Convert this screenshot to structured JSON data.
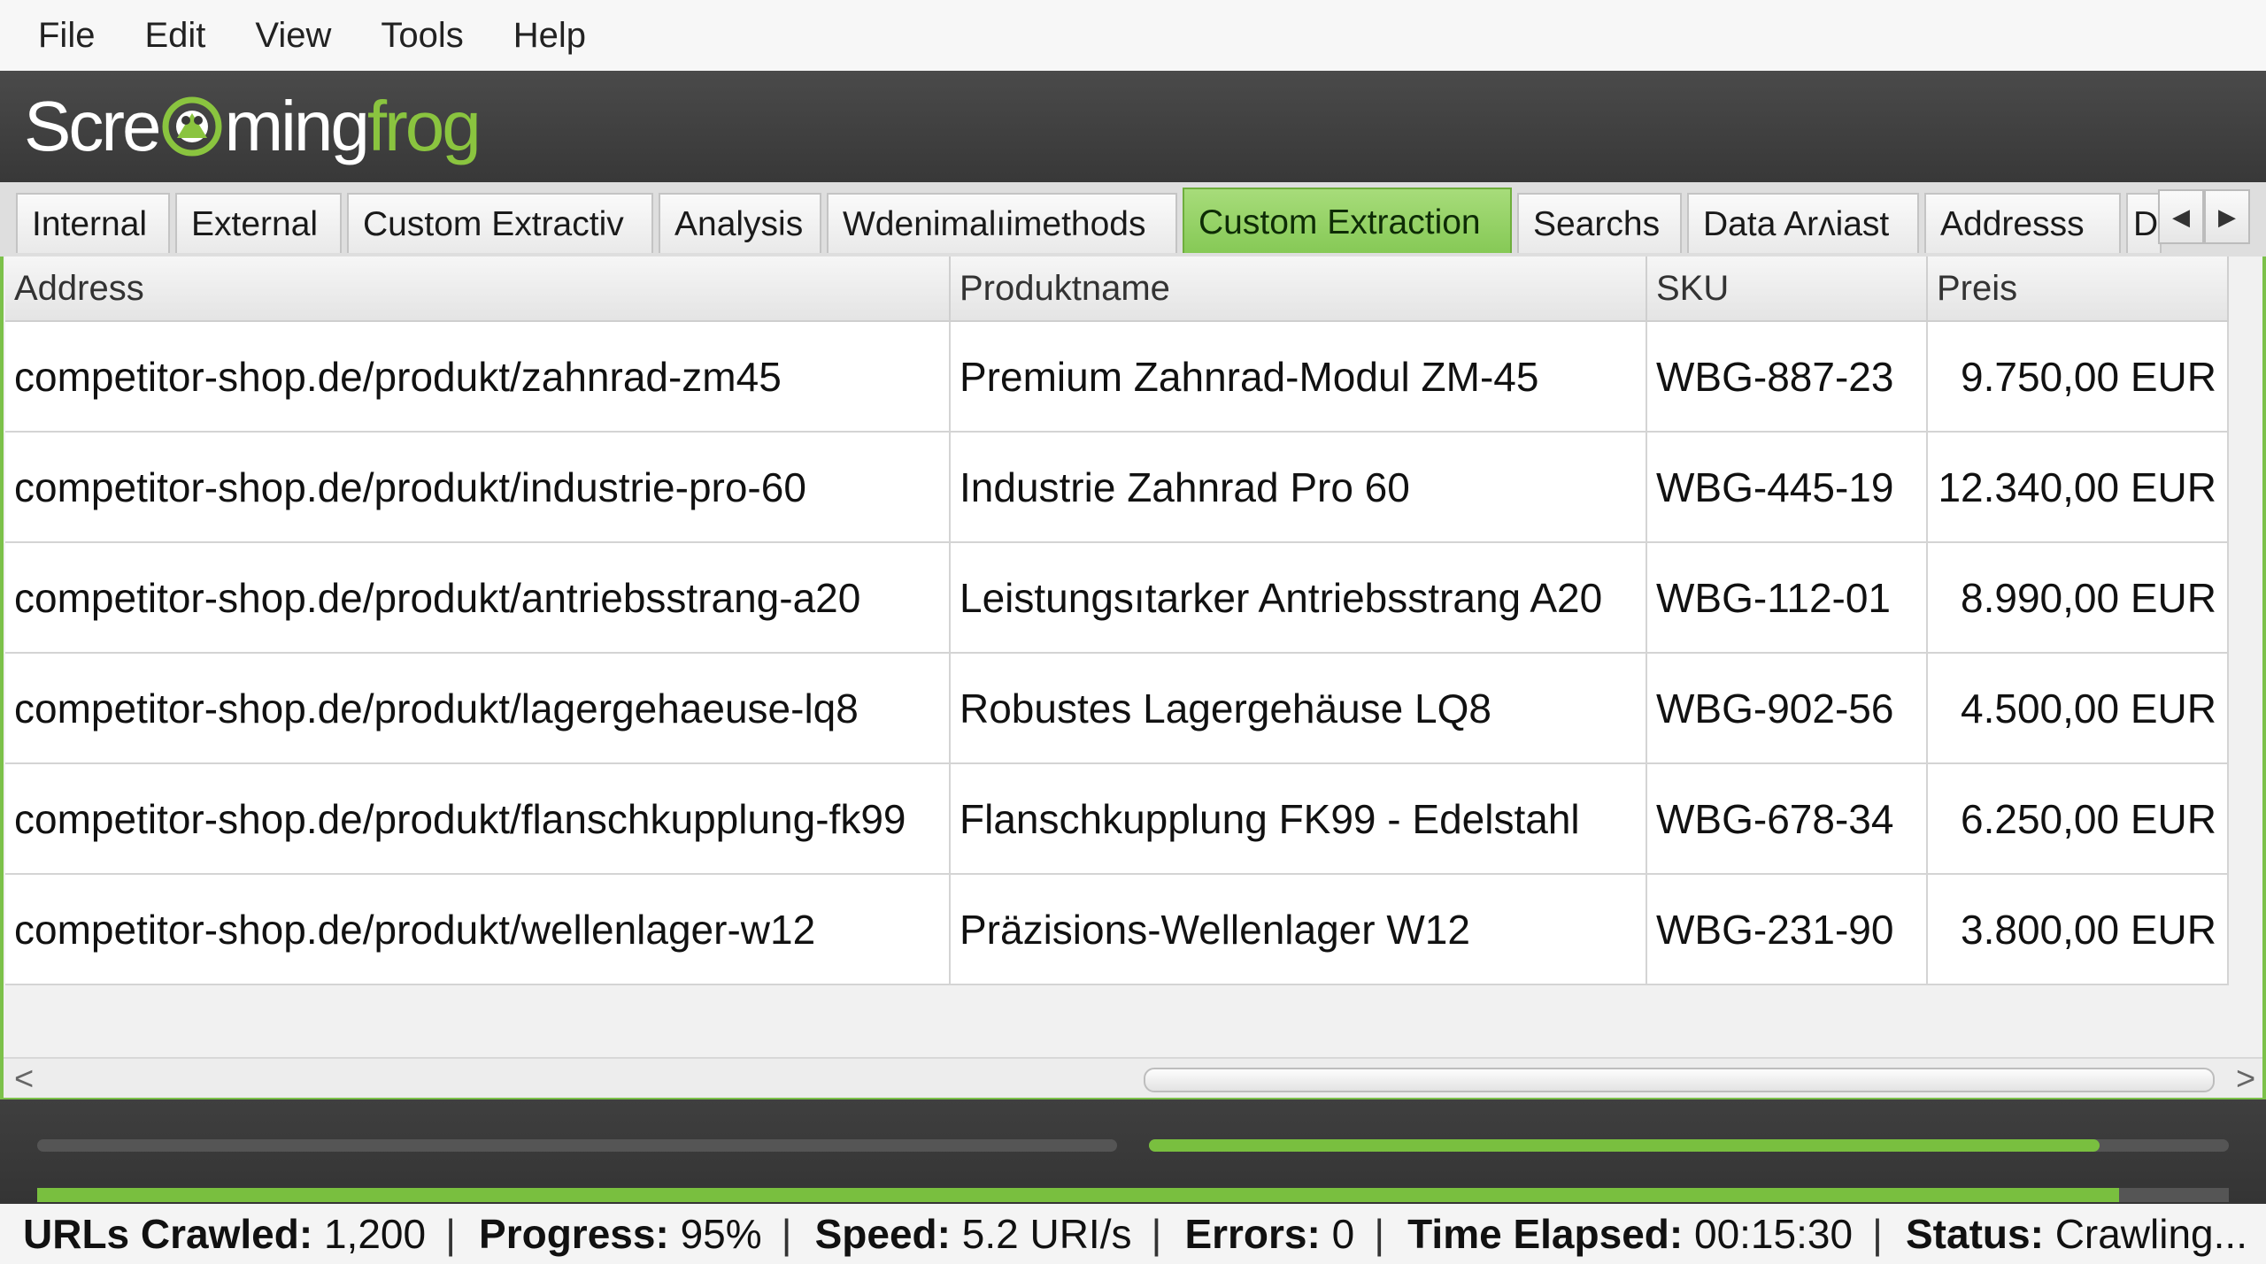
{
  "menu": [
    "File",
    "Edit",
    "View",
    "Tools",
    "Help"
  ],
  "brand": {
    "logo_white": "Scre",
    "logo_white2": "ming",
    "logo_green": "frog",
    "logo_icon": "frog-mascot-icon",
    "accent_color": "#8ac43f"
  },
  "tabs": [
    {
      "label": "Internal",
      "active": false
    },
    {
      "label": "External",
      "active": false
    },
    {
      "label": "Custom Extractiv",
      "active": false
    },
    {
      "label": "Analysis",
      "active": false
    },
    {
      "label": "Wdenimalıimethods",
      "active": false
    },
    {
      "label": "Custom Extraction",
      "active": true
    },
    {
      "label": "Searchs",
      "active": false
    },
    {
      "label": "Data Arʌiast",
      "active": false
    },
    {
      "label": "Addresss",
      "active": false
    },
    {
      "label": "D",
      "active": false
    }
  ],
  "tab_nav": {
    "prev_icon": "chevron-left-icon",
    "next_icon": "chevron-right-icon"
  },
  "table": {
    "columns": [
      "Address",
      "Produktname",
      "SKU",
      "Preis"
    ],
    "rows": [
      [
        "competitor-shop.de/produkt/zahnrad-zm45",
        "Premium Zahnrad-Modul ZM-45",
        "WBG-887-23",
        "9.750,00 EUR"
      ],
      [
        "competitor-shop.de/produkt/industrie-pro-60",
        "Industrie Zahnrad Pro 60",
        "WBG-445-19",
        "12.340,00 EUR"
      ],
      [
        "competitor-shop.de/produkt/antriebsstrang-a20",
        "Leistungsıtarker Antriebsstrang A20",
        "WBG-112-01",
        "8.990,00 EUR"
      ],
      [
        "competitor-shop.de/produkt/lagergehaeuse-lq8",
        "Robustes Lagergehäuse LQ8",
        "WBG-902-56",
        "4.500,00 EUR"
      ],
      [
        "competitor-shop.de/produkt/flanschkupplung-fk99",
        "Flanschkupplung FK99 - Edelstahl",
        "WBG-678-34",
        "6.250,00 EUR"
      ],
      [
        "competitor-shop.de/produkt/wellenlager-w12",
        "Präzisions-Wellenlager W12",
        "WBG-231-90",
        "3.800,00 EUR"
      ]
    ]
  },
  "scroll": {
    "left_arrow": "<",
    "right_arrow": ">"
  },
  "progress": {
    "bar1_fraction": 0.0,
    "bar2_fraction": 0.88,
    "bar3_fraction": 0.95,
    "color": "#79bf3f"
  },
  "status": {
    "urls_label": "URLs Crawled:",
    "urls_value": "1,200",
    "progress_label": "Progress:",
    "progress_value": "95%",
    "speed_label": "Speed:",
    "speed_value": "5.2 URI/s",
    "errors_label": "Errors:",
    "errors_value": "0",
    "time_label": "Time Elapsed:",
    "time_value": "00:15:30",
    "status_label": "Status:",
    "status_value": "Crawling..."
  }
}
